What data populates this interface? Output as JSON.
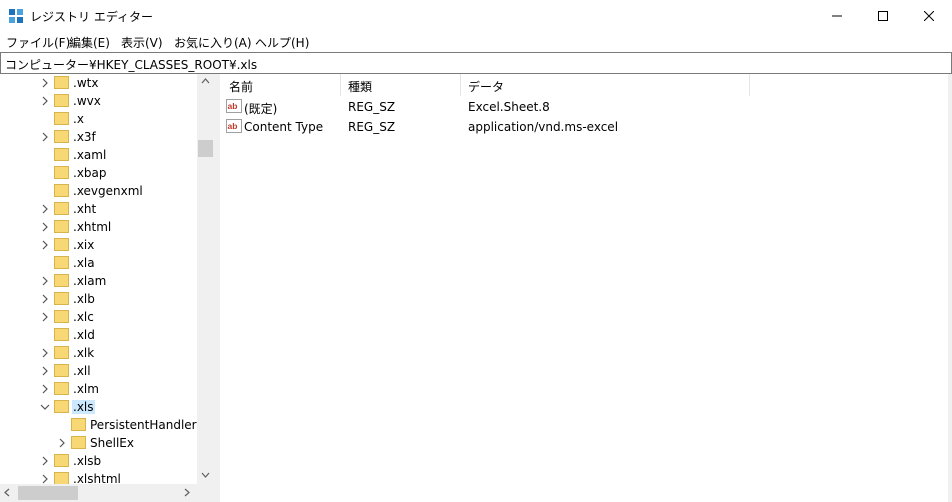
{
  "window": {
    "title": "レジストリ エディター"
  },
  "menu": [
    {
      "label": "ファイル(F)"
    },
    {
      "label": "編集(E)"
    },
    {
      "label": "表示(V)"
    },
    {
      "label": "お気に入り(A)"
    },
    {
      "label": "ヘルプ(H)"
    }
  ],
  "address": {
    "path": "コンピューター¥HKEY_CLASSES_ROOT¥.xls"
  },
  "tree": {
    "items": [
      {
        "label": ".wtx",
        "expander": "collapsed",
        "level": 0
      },
      {
        "label": ".wvx",
        "expander": "collapsed",
        "level": 0
      },
      {
        "label": ".x",
        "expander": "none",
        "level": 0
      },
      {
        "label": ".x3f",
        "expander": "collapsed",
        "level": 0
      },
      {
        "label": ".xaml",
        "expander": "none",
        "level": 0
      },
      {
        "label": ".xbap",
        "expander": "none",
        "level": 0
      },
      {
        "label": ".xevgenxml",
        "expander": "none",
        "level": 0
      },
      {
        "label": ".xht",
        "expander": "collapsed",
        "level": 0
      },
      {
        "label": ".xhtml",
        "expander": "collapsed",
        "level": 0
      },
      {
        "label": ".xix",
        "expander": "collapsed",
        "level": 0
      },
      {
        "label": ".xla",
        "expander": "none",
        "level": 0
      },
      {
        "label": ".xlam",
        "expander": "collapsed",
        "level": 0
      },
      {
        "label": ".xlb",
        "expander": "collapsed",
        "level": 0
      },
      {
        "label": ".xlc",
        "expander": "collapsed",
        "level": 0
      },
      {
        "label": ".xld",
        "expander": "none",
        "level": 0
      },
      {
        "label": ".xlk",
        "expander": "collapsed",
        "level": 0
      },
      {
        "label": ".xll",
        "expander": "collapsed",
        "level": 0
      },
      {
        "label": ".xlm",
        "expander": "collapsed",
        "level": 0
      },
      {
        "label": ".xls",
        "expander": "expanded",
        "level": 0,
        "selected": true
      },
      {
        "label": "PersistentHandler",
        "expander": "none",
        "level": 1
      },
      {
        "label": "ShellEx",
        "expander": "collapsed",
        "level": 1
      },
      {
        "label": ".xlsb",
        "expander": "collapsed",
        "level": 0
      },
      {
        "label": ".xlshtml",
        "expander": "collapsed",
        "level": 0
      }
    ]
  },
  "list": {
    "columns": [
      {
        "label": "名前"
      },
      {
        "label": "種類"
      },
      {
        "label": "データ"
      }
    ],
    "rows": [
      {
        "name": "(既定)",
        "type": "REG_SZ",
        "data": "Excel.Sheet.8",
        "icon": "string-value-icon"
      },
      {
        "name": "Content Type",
        "type": "REG_SZ",
        "data": "application/vnd.ms-excel",
        "icon": "string-value-icon"
      }
    ]
  },
  "colors": {
    "selection": "#cce8ff",
    "folder": "#f8d775",
    "scrollbar": "#f0f0f0",
    "value_icon": "#c0392b"
  }
}
